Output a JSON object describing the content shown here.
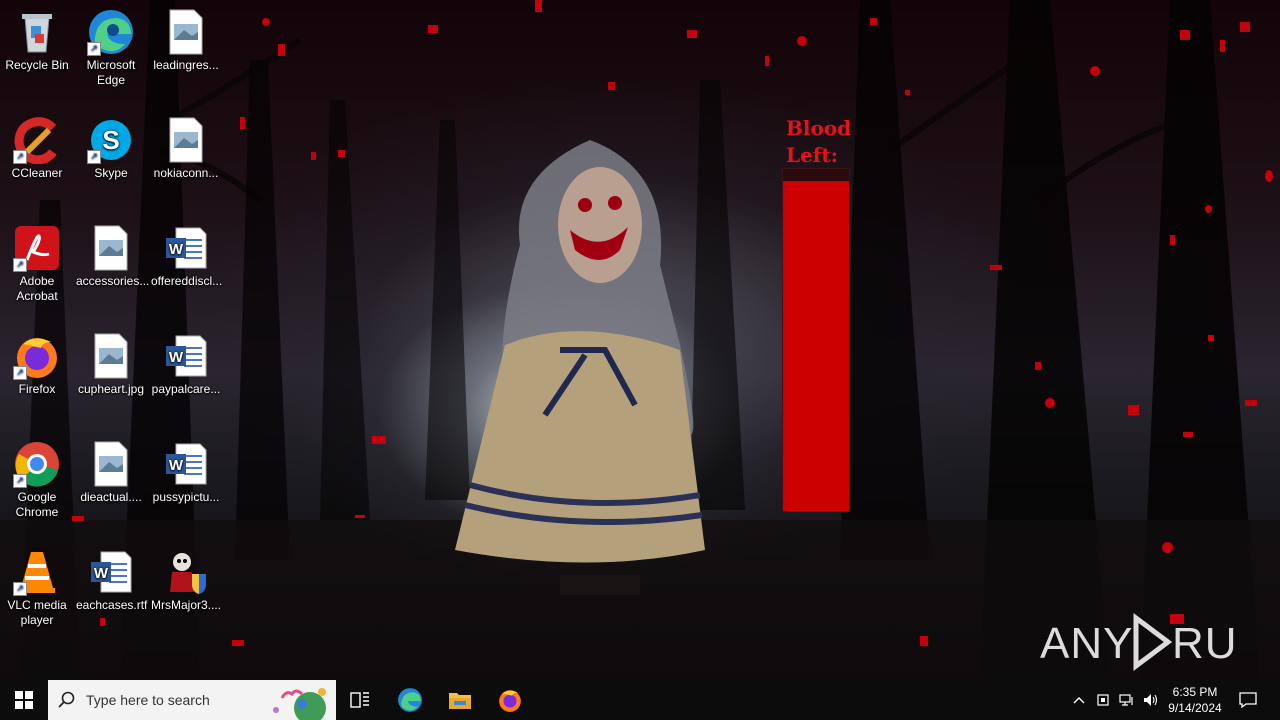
{
  "desktop_icons": [
    {
      "label": "Recycle Bin",
      "icon": "recycle-bin-icon"
    },
    {
      "label": "Microsoft Edge",
      "icon": "edge-icon"
    },
    {
      "label": "leadingres...",
      "icon": "image-file-icon"
    },
    {
      "label": "CCleaner",
      "icon": "ccleaner-icon"
    },
    {
      "label": "Skype",
      "icon": "skype-icon"
    },
    {
      "label": "nokiaconn...",
      "icon": "image-file-icon"
    },
    {
      "label": "Adobe Acrobat",
      "icon": "acrobat-icon"
    },
    {
      "label": "accessories...",
      "icon": "image-file-icon"
    },
    {
      "label": "offereddiscl...",
      "icon": "word-doc-icon"
    },
    {
      "label": "Firefox",
      "icon": "firefox-icon"
    },
    {
      "label": "cupheart.jpg",
      "icon": "image-file-icon"
    },
    {
      "label": "paypalcare...",
      "icon": "word-doc-icon"
    },
    {
      "label": "Google Chrome",
      "icon": "chrome-icon"
    },
    {
      "label": "dieactual....",
      "icon": "image-file-icon"
    },
    {
      "label": "pussypictu...",
      "icon": "word-doc-icon"
    },
    {
      "label": "VLC media player",
      "icon": "vlc-icon"
    },
    {
      "label": "eachcases.rtf",
      "icon": "word-doc-icon"
    },
    {
      "label": "MrsMajor3....",
      "icon": "skull-shield-icon"
    }
  ],
  "meter": {
    "label": "Blood Left:",
    "level_percent": 100,
    "color": "#cc0000"
  },
  "watermark": "ANY RUN",
  "taskbar": {
    "search_placeholder": "Type here to search",
    "time": "6:35 PM",
    "date": "9/14/2024"
  },
  "colors": {
    "blood": "#c4000d",
    "taskbar": "#0c0c0c"
  }
}
